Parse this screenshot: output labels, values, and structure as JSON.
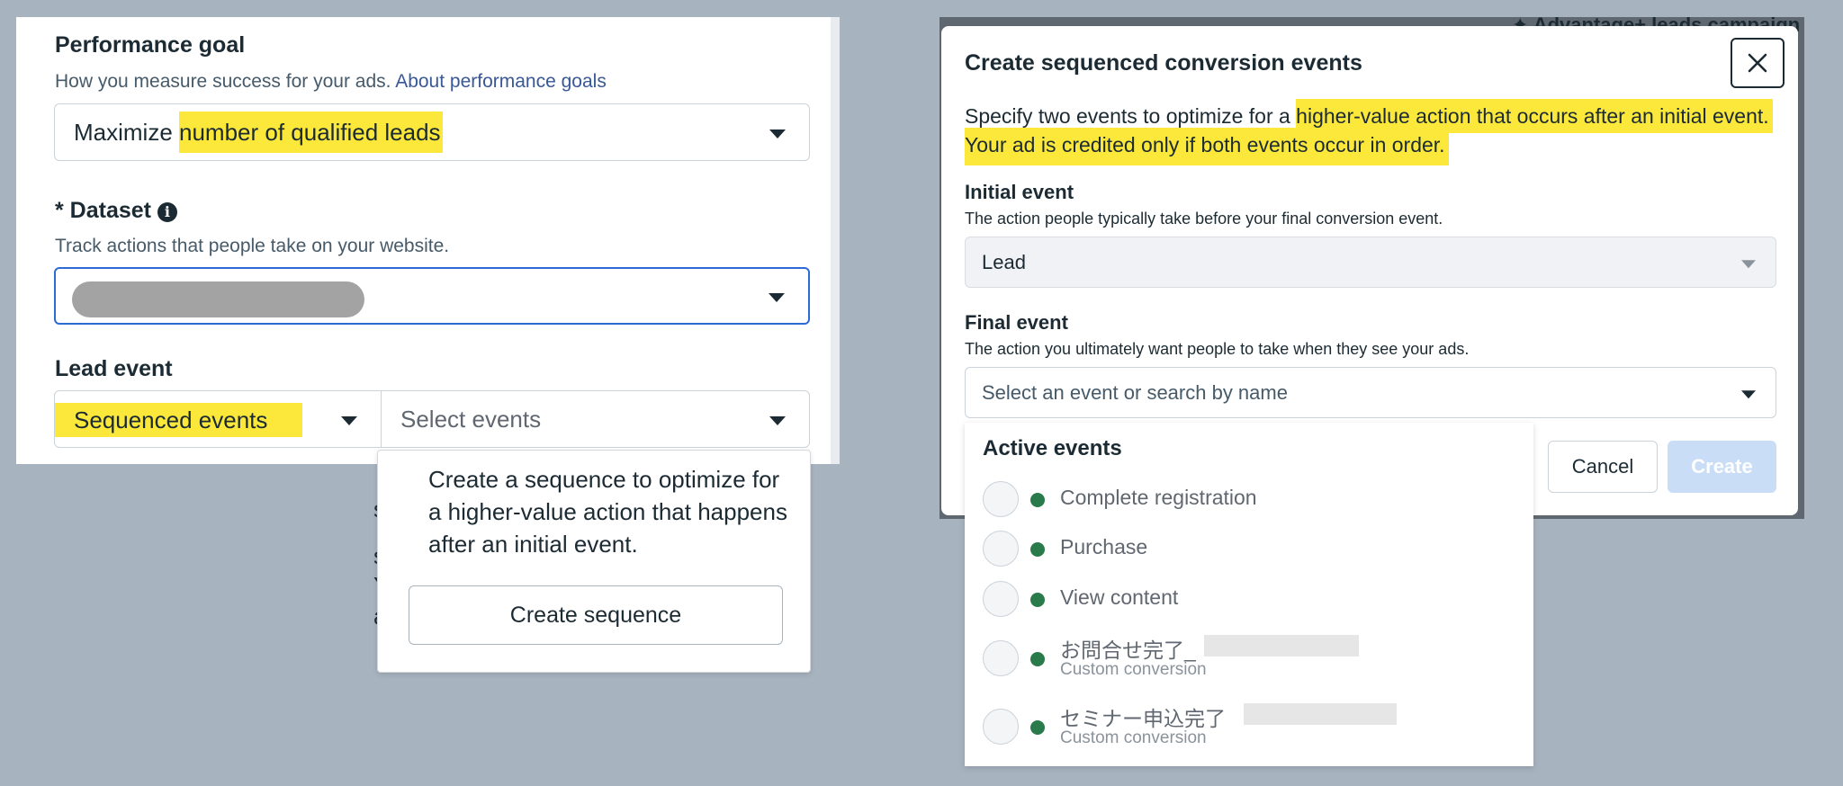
{
  "left": {
    "performance_goal": {
      "title": "Performance goal",
      "subtitle": "How you measure success for your ads.",
      "link": "About performance goals",
      "select_prefix": "Maximize ",
      "select_highlight": "number of qualified leads"
    },
    "dataset": {
      "title": "* Dataset",
      "subtitle": "Track actions that people take on your website."
    },
    "lead_event": {
      "title": "Lead event",
      "type_value": "Sequenced events",
      "events_placeholder": "Select events"
    },
    "popover": {
      "text": "Create a sequence to optimize for a higher-value action that happens after an initial event.",
      "button": "Create sequence"
    },
    "bleed_chars": [
      "s",
      "s",
      "Y",
      "a"
    ]
  },
  "background": {
    "partial_title": "✦ Advantage+ leads campaign"
  },
  "modal": {
    "title": "Create sequenced conversion events",
    "desc_plain": "Specify two events to optimize for a ",
    "desc_highlight_1": "higher-value action that occurs after an initial event.",
    "desc_highlight_2": "Your ad is credited only if both events occur in order.",
    "initial": {
      "label": "Initial event",
      "sub": "The action people typically take before your final conversion event.",
      "value": "Lead"
    },
    "final": {
      "label": "Final event",
      "sub": "The action you ultimately want people to take when they see your ads.",
      "placeholder": "Select an event or search by name"
    },
    "cancel": "Cancel",
    "create": "Create"
  },
  "events": {
    "title": "Active events",
    "items": [
      {
        "name": "Complete registration",
        "sub": ""
      },
      {
        "name": "Purchase",
        "sub": ""
      },
      {
        "name": "View content",
        "sub": ""
      },
      {
        "name": "お問合せ完了_",
        "sub": "Custom conversion"
      },
      {
        "name": "セミナー申込完了",
        "sub": "Custom conversion"
      }
    ]
  },
  "colors": {
    "highlight": "#fbe83a",
    "link": "#385898",
    "status_dot": "#2b7a4b",
    "create_disabled": "#c9ddf7",
    "page_bg": "#a7b3bf"
  }
}
